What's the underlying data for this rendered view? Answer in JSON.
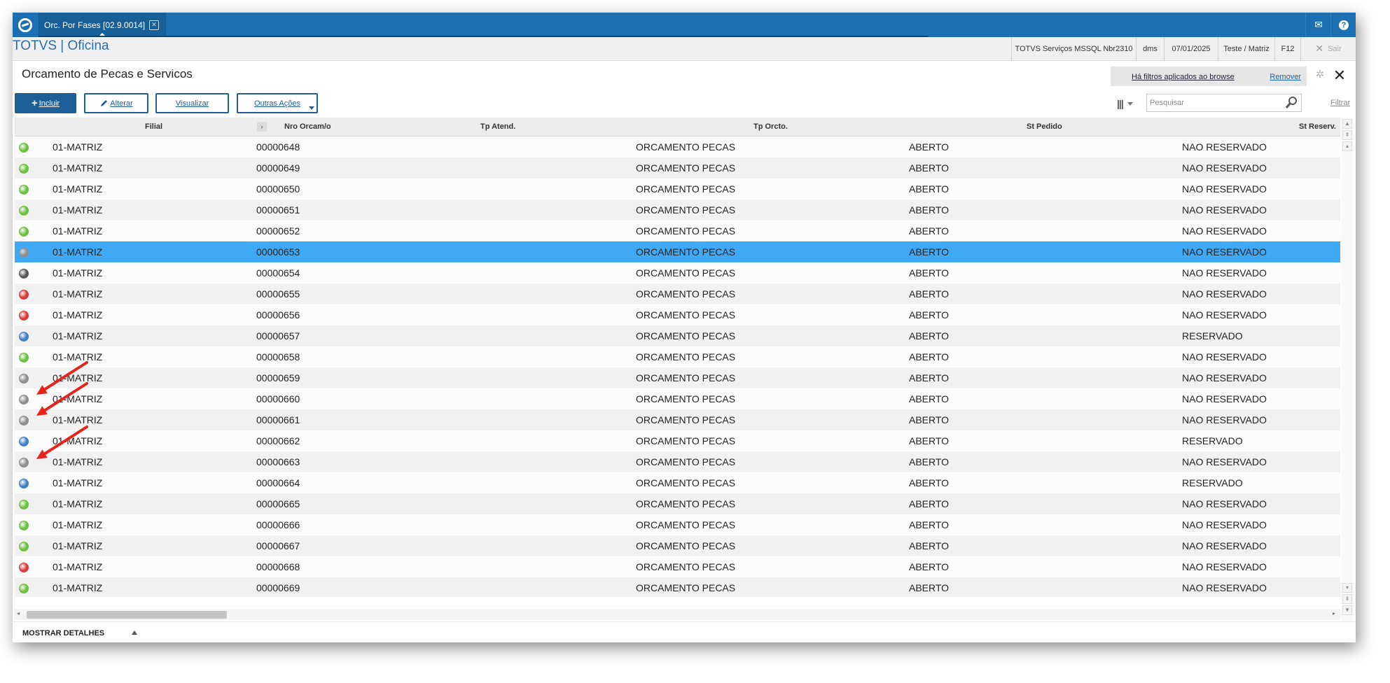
{
  "window": {
    "tab_title": "Orc. Por Fases [02.9.0014]",
    "app_title": "TOTVS | Oficina",
    "session": {
      "server": "TOTVS Serviços MSSQL Nbr2310",
      "user": "dms",
      "date": "07/01/2025",
      "branch": "Teste / Matriz",
      "shortcut": "F12",
      "exit_label": "Sair"
    }
  },
  "page": {
    "title": "Orcamento de Pecas e Servicos",
    "filter_message": "Há filtros aplicados ao browse",
    "filter_remove": "Remover"
  },
  "toolbar": {
    "incluir": "Incluir",
    "alterar": "Alterar",
    "visualizar": "Visualizar",
    "outras": "Outras Ações",
    "search_placeholder": "Pesquisar",
    "filtrar": "Filtrar"
  },
  "grid": {
    "columns": [
      "Filial",
      "Nro Orcam/o",
      "Tp Atend.",
      "Tp Orcto.",
      "St Pedido",
      "St Reserv."
    ],
    "status_colors": {
      "green": "#6dbf3f",
      "gray": "#8e8e8e",
      "darkgray": "#5a5a5a",
      "red": "#d83a3a",
      "blue": "#3f7fc2"
    },
    "selected_color": "#3fa9f5",
    "rows": [
      {
        "status": "green",
        "filial": "01-MATRIZ",
        "nro": "00000648",
        "tp_orcto": "ORCAMENTO PECAS",
        "st_pedido": "ABERTO",
        "st_reserv": "NAO RESERVADO"
      },
      {
        "status": "green",
        "filial": "01-MATRIZ",
        "nro": "00000649",
        "tp_orcto": "ORCAMENTO PECAS",
        "st_pedido": "ABERTO",
        "st_reserv": "NAO RESERVADO"
      },
      {
        "status": "green",
        "filial": "01-MATRIZ",
        "nro": "00000650",
        "tp_orcto": "ORCAMENTO PECAS",
        "st_pedido": "ABERTO",
        "st_reserv": "NAO RESERVADO"
      },
      {
        "status": "green",
        "filial": "01-MATRIZ",
        "nro": "00000651",
        "tp_orcto": "ORCAMENTO PECAS",
        "st_pedido": "ABERTO",
        "st_reserv": "NAO RESERVADO"
      },
      {
        "status": "green",
        "filial": "01-MATRIZ",
        "nro": "00000652",
        "tp_orcto": "ORCAMENTO PECAS",
        "st_pedido": "ABERTO",
        "st_reserv": "NAO RESERVADO"
      },
      {
        "status": "gray",
        "filial": "01-MATRIZ",
        "nro": "00000653",
        "tp_orcto": "ORCAMENTO PECAS",
        "st_pedido": "ABERTO",
        "st_reserv": "NAO RESERVADO",
        "selected": true
      },
      {
        "status": "darkgray",
        "filial": "01-MATRIZ",
        "nro": "00000654",
        "tp_orcto": "ORCAMENTO PECAS",
        "st_pedido": "ABERTO",
        "st_reserv": "NAO RESERVADO"
      },
      {
        "status": "red",
        "filial": "01-MATRIZ",
        "nro": "00000655",
        "tp_orcto": "ORCAMENTO PECAS",
        "st_pedido": "ABERTO",
        "st_reserv": "NAO RESERVADO"
      },
      {
        "status": "red",
        "filial": "01-MATRIZ",
        "nro": "00000656",
        "tp_orcto": "ORCAMENTO PECAS",
        "st_pedido": "ABERTO",
        "st_reserv": "NAO RESERVADO"
      },
      {
        "status": "blue",
        "filial": "01-MATRIZ",
        "nro": "00000657",
        "tp_orcto": "ORCAMENTO PECAS",
        "st_pedido": "ABERTO",
        "st_reserv": "RESERVADO"
      },
      {
        "status": "green",
        "filial": "01-MATRIZ",
        "nro": "00000658",
        "tp_orcto": "ORCAMENTO PECAS",
        "st_pedido": "ABERTO",
        "st_reserv": "NAO RESERVADO"
      },
      {
        "status": "gray",
        "filial": "01-MATRIZ",
        "nro": "00000659",
        "tp_orcto": "ORCAMENTO PECAS",
        "st_pedido": "ABERTO",
        "st_reserv": "NAO RESERVADO"
      },
      {
        "status": "gray",
        "filial": "01-MATRIZ",
        "nro": "00000660",
        "tp_orcto": "ORCAMENTO PECAS",
        "st_pedido": "ABERTO",
        "st_reserv": "NAO RESERVADO"
      },
      {
        "status": "gray",
        "filial": "01-MATRIZ",
        "nro": "00000661",
        "tp_orcto": "ORCAMENTO PECAS",
        "st_pedido": "ABERTO",
        "st_reserv": "NAO RESERVADO"
      },
      {
        "status": "blue",
        "filial": "01-MATRIZ",
        "nro": "00000662",
        "tp_orcto": "ORCAMENTO PECAS",
        "st_pedido": "ABERTO",
        "st_reserv": "RESERVADO"
      },
      {
        "status": "gray",
        "filial": "01-MATRIZ",
        "nro": "00000663",
        "tp_orcto": "ORCAMENTO PECAS",
        "st_pedido": "ABERTO",
        "st_reserv": "NAO RESERVADO"
      },
      {
        "status": "blue",
        "filial": "01-MATRIZ",
        "nro": "00000664",
        "tp_orcto": "ORCAMENTO PECAS",
        "st_pedido": "ABERTO",
        "st_reserv": "RESERVADO"
      },
      {
        "status": "green",
        "filial": "01-MATRIZ",
        "nro": "00000665",
        "tp_orcto": "ORCAMENTO PECAS",
        "st_pedido": "ABERTO",
        "st_reserv": "NAO RESERVADO"
      },
      {
        "status": "green",
        "filial": "01-MATRIZ",
        "nro": "00000666",
        "tp_orcto": "ORCAMENTO PECAS",
        "st_pedido": "ABERTO",
        "st_reserv": "NAO RESERVADO"
      },
      {
        "status": "green",
        "filial": "01-MATRIZ",
        "nro": "00000667",
        "tp_orcto": "ORCAMENTO PECAS",
        "st_pedido": "ABERTO",
        "st_reserv": "NAO RESERVADO"
      },
      {
        "status": "red",
        "filial": "01-MATRIZ",
        "nro": "00000668",
        "tp_orcto": "ORCAMENTO PECAS",
        "st_pedido": "ABERTO",
        "st_reserv": "NAO RESERVADO"
      },
      {
        "status": "green",
        "filial": "01-MATRIZ",
        "nro": "00000669",
        "tp_orcto": "ORCAMENTO PECAS",
        "st_pedido": "ABERTO",
        "st_reserv": "NAO RESERVADO"
      }
    ]
  },
  "footer": {
    "details_label": "MOSTRAR DETALHES"
  },
  "annotations": {
    "arrow_color": "#e8231c",
    "arrow_icons": [
      "red-arrow-icon",
      "red-arrow-icon",
      "red-arrow-icon"
    ]
  }
}
